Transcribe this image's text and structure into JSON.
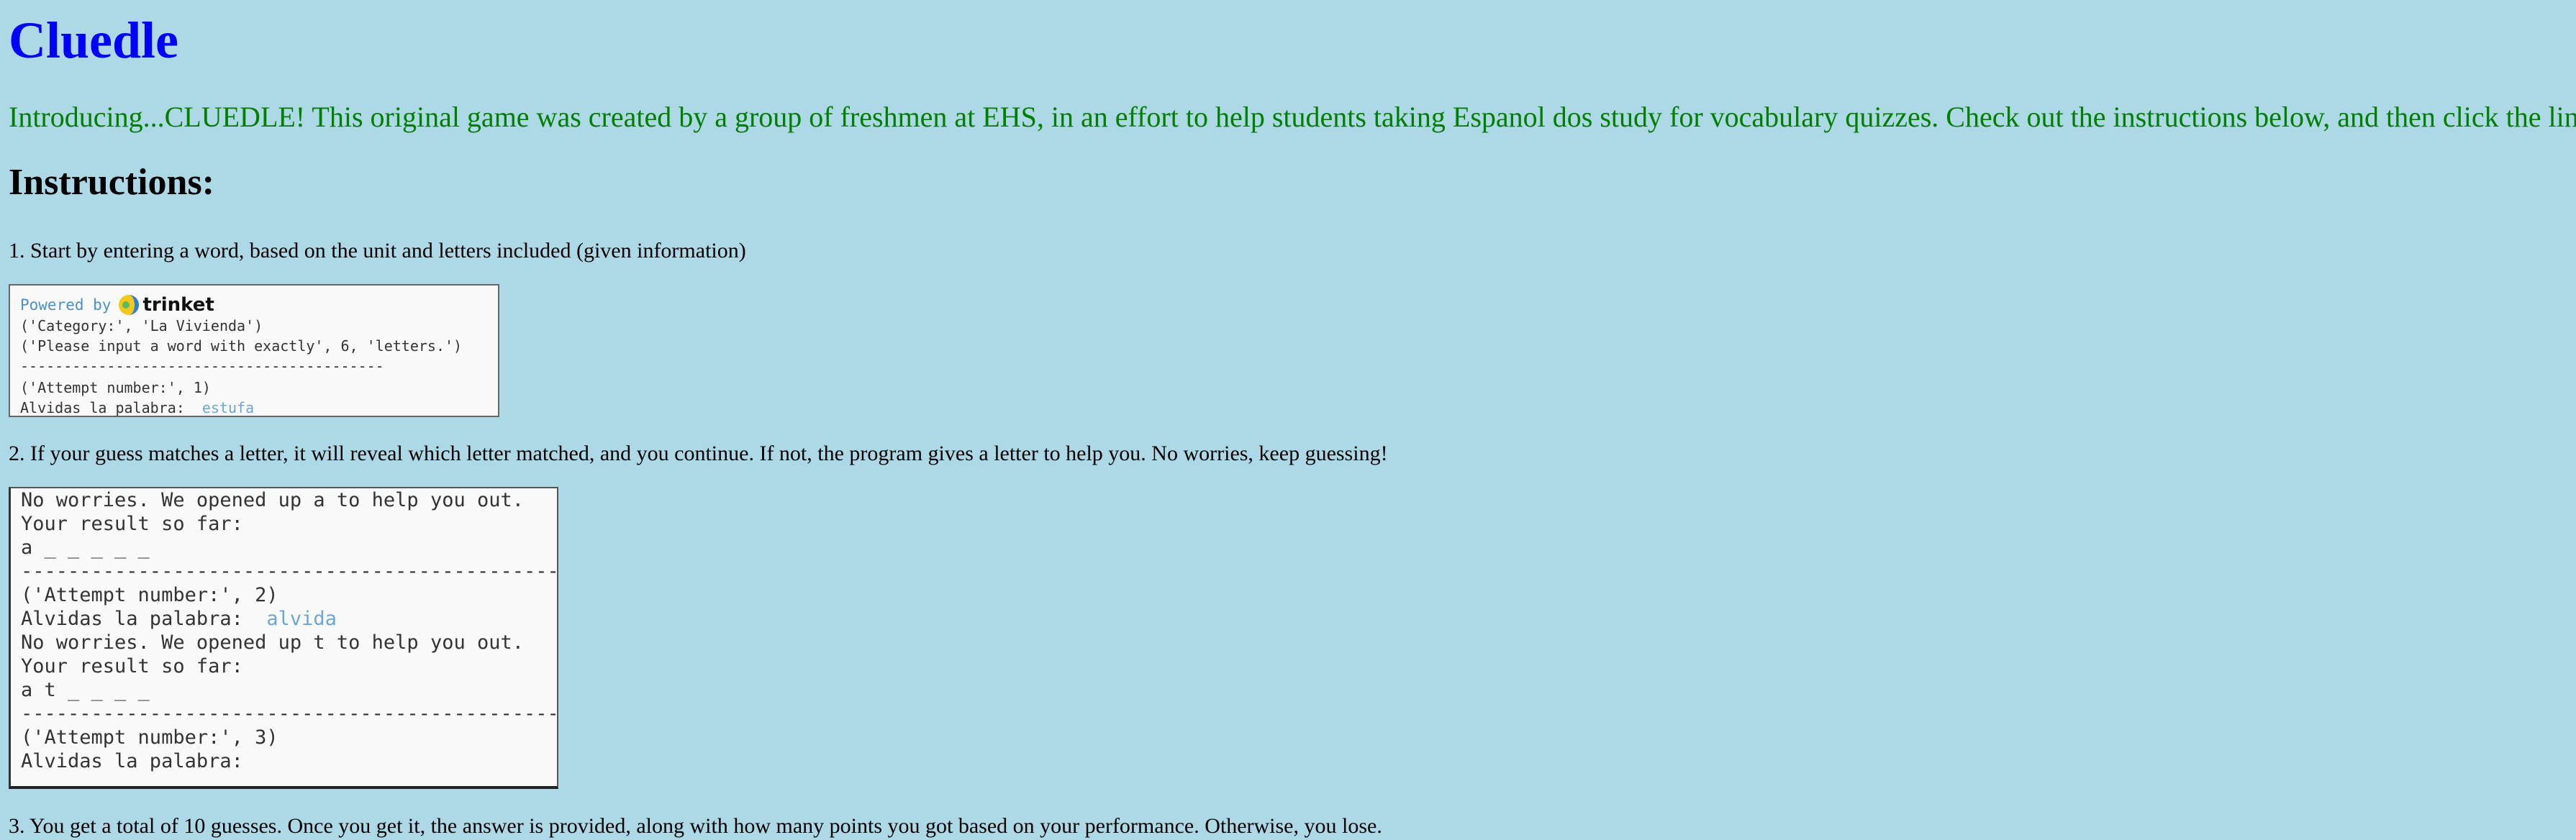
{
  "page": {
    "title": "Cluedle",
    "intro": "Introducing...CLUEDLE! This original game was created by a group of freshmen at EHS, in an effort to help students taking Espanol dos study for vocabulary quizzes. Check out the instructions below, and then click the link to play!",
    "instructions_heading": "Instructions:",
    "step1": "1. Start by entering a word, based on the unit and letters included (given information)",
    "step2": "2. If your guess matches a letter, it will reveal which letter matched, and you continue. If not, the program gives a letter to help you. No worries, keep guessing!",
    "step3": "3. You get a total of 10 guesses. Once you get it, the answer is provided, along with how many points you got based on your performance. Otherwise, you lose."
  },
  "colors": {
    "background": "#add8e6",
    "title": "#0000ff",
    "intro": "#008000",
    "console_input": "#6aa6d6"
  },
  "console1": {
    "powered_by": "Powered by",
    "brand": "trinket",
    "brand_icon": "trinket-logo-icon",
    "lines": [
      "('Category:', 'La Vivienda')",
      "('Please input a word with exactly', 6, 'letters.')",
      "------------------------------------------",
      "('Attempt number:', 1)"
    ],
    "prompt": "Alvidas la palabra:",
    "input": "estufa"
  },
  "console2": {
    "line1": "No worries. We opened up a to help you out.",
    "line2": "Your result so far:",
    "line3": "a _ _ _ _ _",
    "line4": "------------------------------------------------",
    "line5": "('Attempt number:', 2)",
    "line6_prompt": "Alvidas la palabra:",
    "line6_input": "alvida",
    "line7": "No worries. We opened up t to help you out.",
    "line8": "Your result so far:",
    "line9": "a t _ _ _ _",
    "line10": "------------------------------------------------",
    "line11": "('Attempt number:', 3)",
    "line12": "Alvidas la palabra:"
  }
}
